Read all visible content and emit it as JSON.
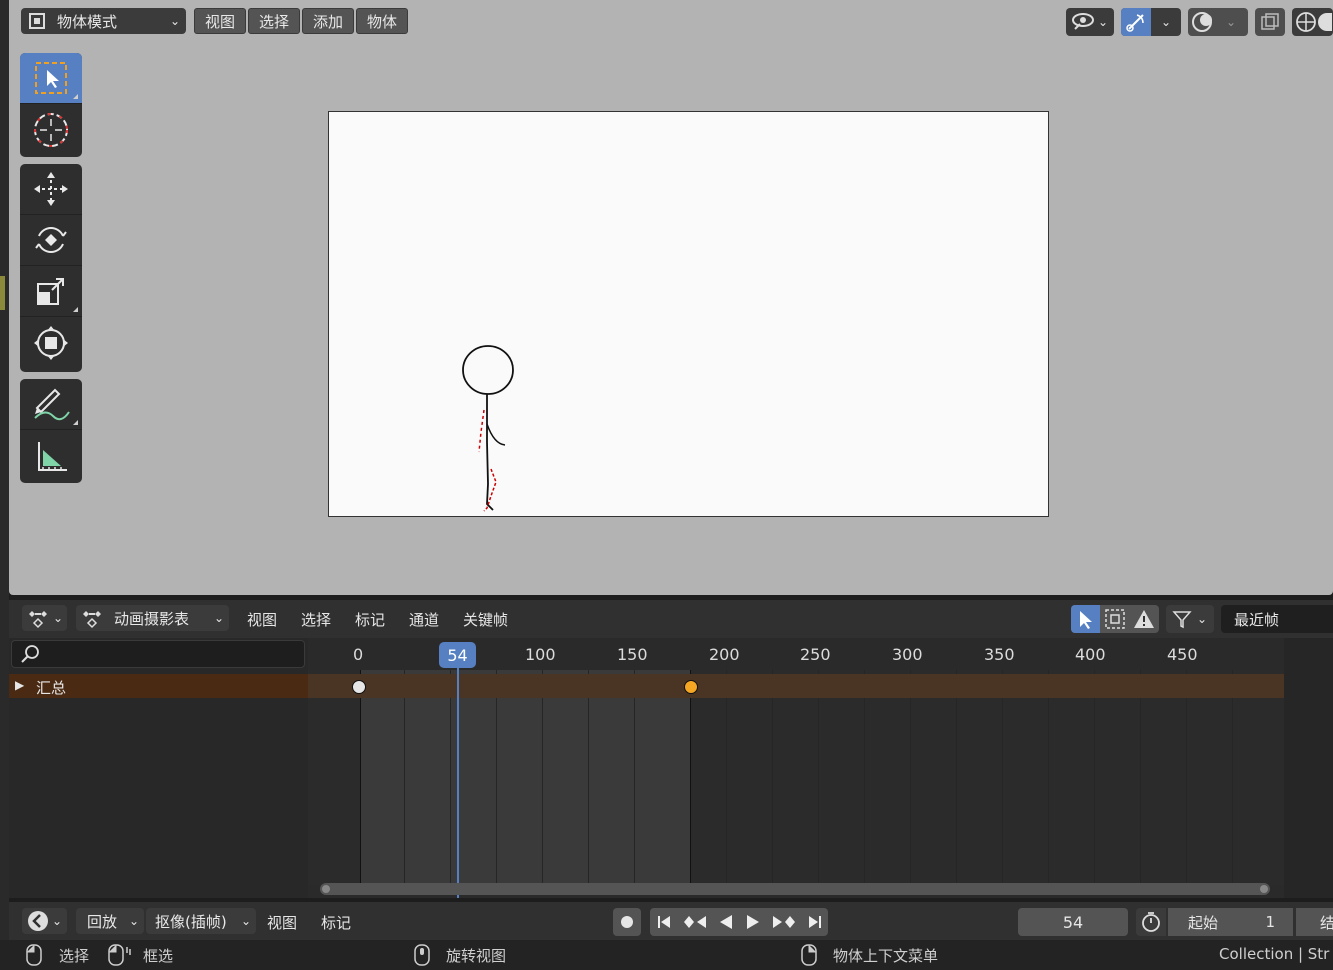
{
  "viewport": {
    "mode_label": "物体模式",
    "menus": [
      "视图",
      "选择",
      "添加",
      "物体"
    ]
  },
  "toolbar_icons": [
    "select-box-icon",
    "cursor-icon",
    "move-icon",
    "rotate-icon",
    "scale-icon",
    "transform-icon",
    "annotate-icon",
    "measure-icon"
  ],
  "dopesheet": {
    "editor_mode": "动画摄影表",
    "menus": [
      "视图",
      "选择",
      "标记",
      "通道",
      "关键帧"
    ],
    "snap_label": "最近帧",
    "search_placeholder": "",
    "current_frame": "54",
    "ticks": [
      "0",
      "100",
      "150",
      "200",
      "250",
      "300",
      "350",
      "400",
      "450"
    ],
    "summary_label": "汇总"
  },
  "playback": {
    "playback_label": "回放",
    "keying_label": "抠像(插帧)",
    "menus": [
      "视图",
      "标记"
    ],
    "frame_value": "54",
    "start_label": "起始",
    "start_value": "1",
    "end_label": "结"
  },
  "status": {
    "select": "选择",
    "box_select": "框选",
    "rotate_view": "旋转视图",
    "context_menu": "物体上下文菜单",
    "collection": "Collection | Str"
  },
  "colors": {
    "accent": "#5680c2",
    "keyframe_selected": "#f5a623",
    "keyframe": "#e6e6e6",
    "summary_bg": "#4a2a12"
  }
}
